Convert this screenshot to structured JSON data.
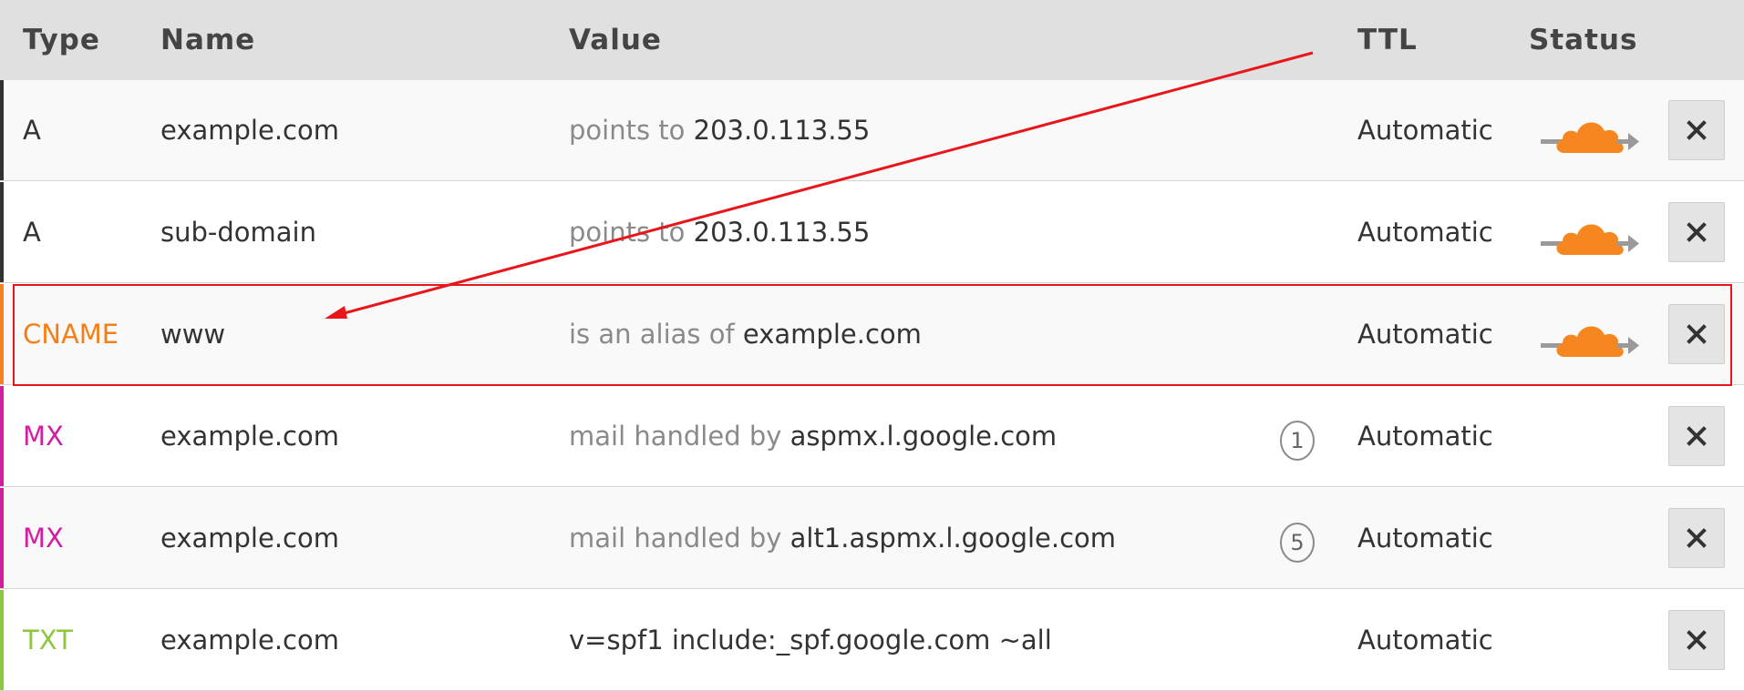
{
  "header": {
    "type": "Type",
    "name": "Name",
    "value": "Value",
    "ttl": "TTL",
    "status": "Status"
  },
  "records": [
    {
      "type": "A",
      "type_color": "#333333",
      "accent": "#333333",
      "name": "example.com",
      "value_prefix": "points to ",
      "value_target": "203.0.113.55",
      "priority": "",
      "ttl": "Automatic",
      "proxied": true,
      "status_icon": "orange-cloud-icon"
    },
    {
      "type": "A",
      "type_color": "#333333",
      "accent": "#333333",
      "name": "sub-domain",
      "value_prefix": "points to ",
      "value_target": "203.0.113.55",
      "priority": "",
      "ttl": "Automatic",
      "proxied": true,
      "status_icon": "orange-cloud-icon"
    },
    {
      "type": "CNAME",
      "type_color": "#f57f17",
      "accent": "#f5821f",
      "name": "www",
      "value_prefix": "is an alias of ",
      "value_target": "example.com",
      "priority": "",
      "ttl": "Automatic",
      "proxied": true,
      "status_icon": "orange-cloud-icon"
    },
    {
      "type": "MX",
      "type_color": "#d21ea0",
      "accent": "#d21ea0",
      "name": "example.com",
      "value_prefix": "mail handled by ",
      "value_target": "aspmx.l.google.com",
      "priority": "1",
      "ttl": "Automatic",
      "proxied": false,
      "status_icon": ""
    },
    {
      "type": "MX",
      "type_color": "#d21ea0",
      "accent": "#d21ea0",
      "name": "example.com",
      "value_prefix": "mail handled by ",
      "value_target": "alt1.aspmx.l.google.com",
      "priority": "5",
      "ttl": "Automatic",
      "proxied": false,
      "status_icon": ""
    },
    {
      "type": "TXT",
      "type_color": "#8dc63f",
      "accent": "#8dc63f",
      "name": "example.com",
      "value_prefix": "",
      "value_target": "v=spf1 include:_spf.google.com ~all",
      "priority": "",
      "ttl": "Automatic",
      "proxied": false,
      "status_icon": ""
    }
  ],
  "delete_icon": "close-icon",
  "annotation": {
    "color": "#e8151a",
    "highlighted_record": "CNAME"
  },
  "colors": {
    "header_bg": "#e0e0e0",
    "cloud_orange": "#f6861f",
    "arrow_grey": "#9a9a9a"
  }
}
